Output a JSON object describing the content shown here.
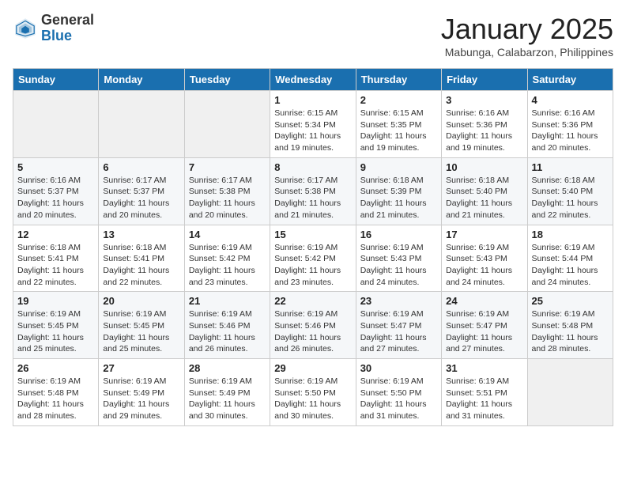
{
  "header": {
    "logo_general": "General",
    "logo_blue": "Blue",
    "month_title": "January 2025",
    "location": "Mabunga, Calabarzon, Philippines"
  },
  "weekdays": [
    "Sunday",
    "Monday",
    "Tuesday",
    "Wednesday",
    "Thursday",
    "Friday",
    "Saturday"
  ],
  "weeks": [
    [
      {
        "day": "",
        "sunrise": "",
        "sunset": "",
        "daylight": ""
      },
      {
        "day": "",
        "sunrise": "",
        "sunset": "",
        "daylight": ""
      },
      {
        "day": "",
        "sunrise": "",
        "sunset": "",
        "daylight": ""
      },
      {
        "day": "1",
        "sunrise": "Sunrise: 6:15 AM",
        "sunset": "Sunset: 5:34 PM",
        "daylight": "Daylight: 11 hours and 19 minutes."
      },
      {
        "day": "2",
        "sunrise": "Sunrise: 6:15 AM",
        "sunset": "Sunset: 5:35 PM",
        "daylight": "Daylight: 11 hours and 19 minutes."
      },
      {
        "day": "3",
        "sunrise": "Sunrise: 6:16 AM",
        "sunset": "Sunset: 5:36 PM",
        "daylight": "Daylight: 11 hours and 19 minutes."
      },
      {
        "day": "4",
        "sunrise": "Sunrise: 6:16 AM",
        "sunset": "Sunset: 5:36 PM",
        "daylight": "Daylight: 11 hours and 20 minutes."
      }
    ],
    [
      {
        "day": "5",
        "sunrise": "Sunrise: 6:16 AM",
        "sunset": "Sunset: 5:37 PM",
        "daylight": "Daylight: 11 hours and 20 minutes."
      },
      {
        "day": "6",
        "sunrise": "Sunrise: 6:17 AM",
        "sunset": "Sunset: 5:37 PM",
        "daylight": "Daylight: 11 hours and 20 minutes."
      },
      {
        "day": "7",
        "sunrise": "Sunrise: 6:17 AM",
        "sunset": "Sunset: 5:38 PM",
        "daylight": "Daylight: 11 hours and 20 minutes."
      },
      {
        "day": "8",
        "sunrise": "Sunrise: 6:17 AM",
        "sunset": "Sunset: 5:38 PM",
        "daylight": "Daylight: 11 hours and 21 minutes."
      },
      {
        "day": "9",
        "sunrise": "Sunrise: 6:18 AM",
        "sunset": "Sunset: 5:39 PM",
        "daylight": "Daylight: 11 hours and 21 minutes."
      },
      {
        "day": "10",
        "sunrise": "Sunrise: 6:18 AM",
        "sunset": "Sunset: 5:40 PM",
        "daylight": "Daylight: 11 hours and 21 minutes."
      },
      {
        "day": "11",
        "sunrise": "Sunrise: 6:18 AM",
        "sunset": "Sunset: 5:40 PM",
        "daylight": "Daylight: 11 hours and 22 minutes."
      }
    ],
    [
      {
        "day": "12",
        "sunrise": "Sunrise: 6:18 AM",
        "sunset": "Sunset: 5:41 PM",
        "daylight": "Daylight: 11 hours and 22 minutes."
      },
      {
        "day": "13",
        "sunrise": "Sunrise: 6:18 AM",
        "sunset": "Sunset: 5:41 PM",
        "daylight": "Daylight: 11 hours and 22 minutes."
      },
      {
        "day": "14",
        "sunrise": "Sunrise: 6:19 AM",
        "sunset": "Sunset: 5:42 PM",
        "daylight": "Daylight: 11 hours and 23 minutes."
      },
      {
        "day": "15",
        "sunrise": "Sunrise: 6:19 AM",
        "sunset": "Sunset: 5:42 PM",
        "daylight": "Daylight: 11 hours and 23 minutes."
      },
      {
        "day": "16",
        "sunrise": "Sunrise: 6:19 AM",
        "sunset": "Sunset: 5:43 PM",
        "daylight": "Daylight: 11 hours and 24 minutes."
      },
      {
        "day": "17",
        "sunrise": "Sunrise: 6:19 AM",
        "sunset": "Sunset: 5:43 PM",
        "daylight": "Daylight: 11 hours and 24 minutes."
      },
      {
        "day": "18",
        "sunrise": "Sunrise: 6:19 AM",
        "sunset": "Sunset: 5:44 PM",
        "daylight": "Daylight: 11 hours and 24 minutes."
      }
    ],
    [
      {
        "day": "19",
        "sunrise": "Sunrise: 6:19 AM",
        "sunset": "Sunset: 5:45 PM",
        "daylight": "Daylight: 11 hours and 25 minutes."
      },
      {
        "day": "20",
        "sunrise": "Sunrise: 6:19 AM",
        "sunset": "Sunset: 5:45 PM",
        "daylight": "Daylight: 11 hours and 25 minutes."
      },
      {
        "day": "21",
        "sunrise": "Sunrise: 6:19 AM",
        "sunset": "Sunset: 5:46 PM",
        "daylight": "Daylight: 11 hours and 26 minutes."
      },
      {
        "day": "22",
        "sunrise": "Sunrise: 6:19 AM",
        "sunset": "Sunset: 5:46 PM",
        "daylight": "Daylight: 11 hours and 26 minutes."
      },
      {
        "day": "23",
        "sunrise": "Sunrise: 6:19 AM",
        "sunset": "Sunset: 5:47 PM",
        "daylight": "Daylight: 11 hours and 27 minutes."
      },
      {
        "day": "24",
        "sunrise": "Sunrise: 6:19 AM",
        "sunset": "Sunset: 5:47 PM",
        "daylight": "Daylight: 11 hours and 27 minutes."
      },
      {
        "day": "25",
        "sunrise": "Sunrise: 6:19 AM",
        "sunset": "Sunset: 5:48 PM",
        "daylight": "Daylight: 11 hours and 28 minutes."
      }
    ],
    [
      {
        "day": "26",
        "sunrise": "Sunrise: 6:19 AM",
        "sunset": "Sunset: 5:48 PM",
        "daylight": "Daylight: 11 hours and 28 minutes."
      },
      {
        "day": "27",
        "sunrise": "Sunrise: 6:19 AM",
        "sunset": "Sunset: 5:49 PM",
        "daylight": "Daylight: 11 hours and 29 minutes."
      },
      {
        "day": "28",
        "sunrise": "Sunrise: 6:19 AM",
        "sunset": "Sunset: 5:49 PM",
        "daylight": "Daylight: 11 hours and 30 minutes."
      },
      {
        "day": "29",
        "sunrise": "Sunrise: 6:19 AM",
        "sunset": "Sunset: 5:50 PM",
        "daylight": "Daylight: 11 hours and 30 minutes."
      },
      {
        "day": "30",
        "sunrise": "Sunrise: 6:19 AM",
        "sunset": "Sunset: 5:50 PM",
        "daylight": "Daylight: 11 hours and 31 minutes."
      },
      {
        "day": "31",
        "sunrise": "Sunrise: 6:19 AM",
        "sunset": "Sunset: 5:51 PM",
        "daylight": "Daylight: 11 hours and 31 minutes."
      },
      {
        "day": "",
        "sunrise": "",
        "sunset": "",
        "daylight": ""
      }
    ]
  ]
}
